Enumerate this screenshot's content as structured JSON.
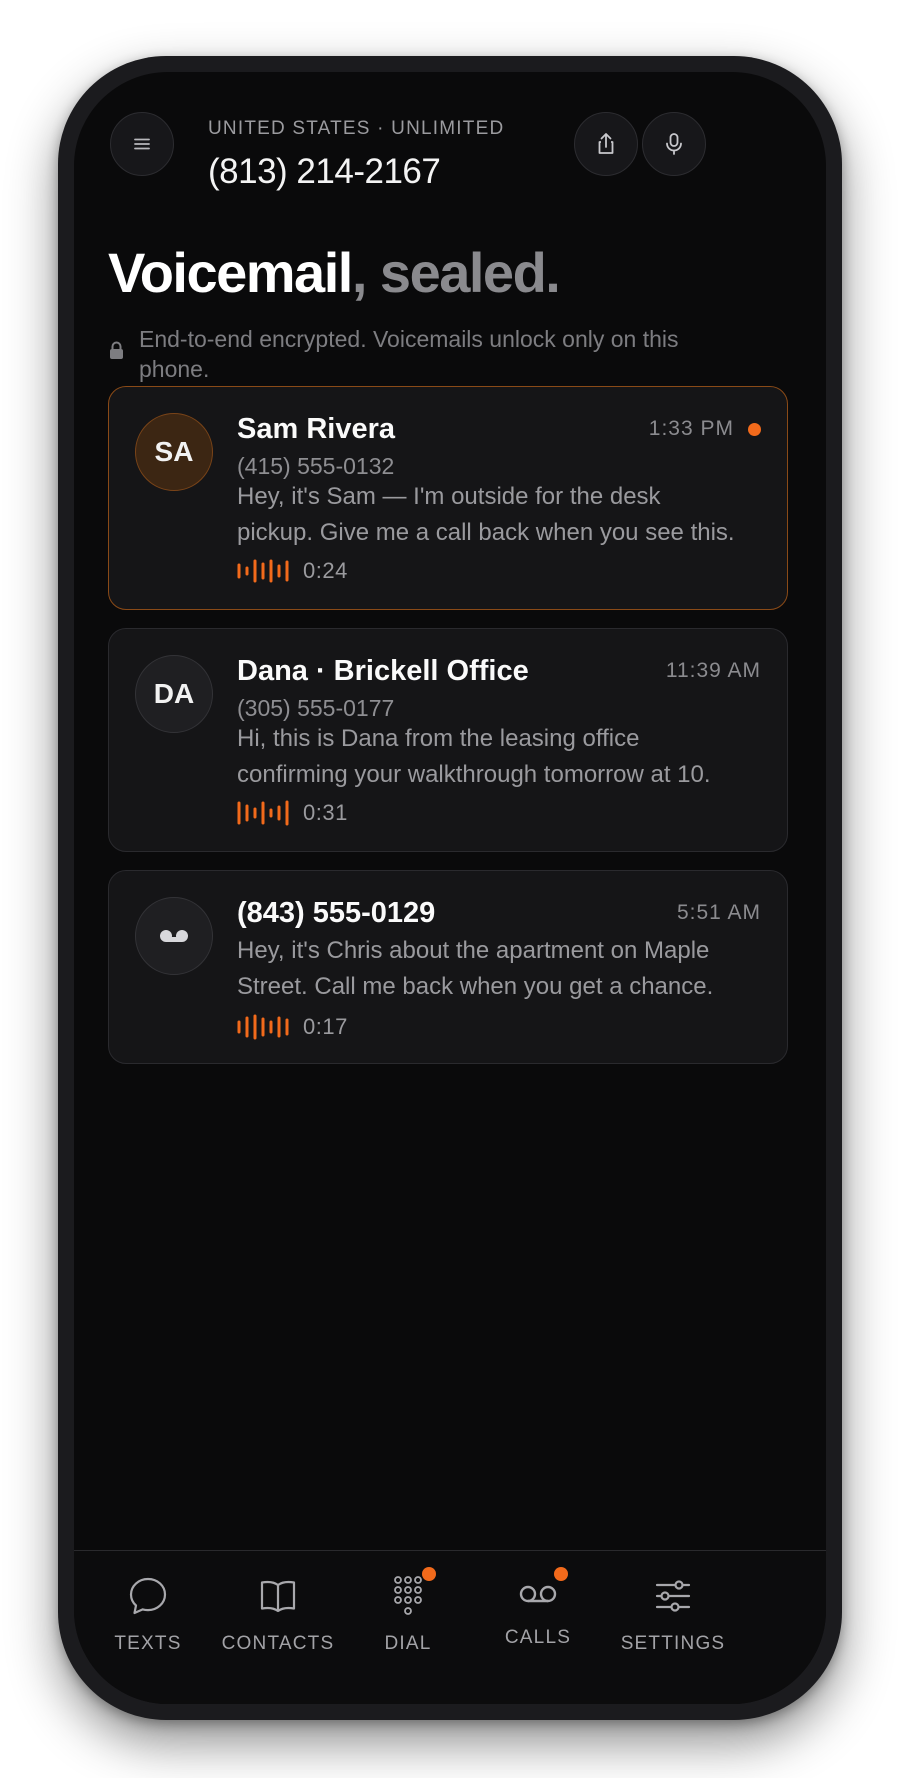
{
  "header": {
    "country": "UNITED STATES · UNLIMITED",
    "number": "(813) 214-2167"
  },
  "title": {
    "main": "Voicemail",
    "accent": ", sealed."
  },
  "encryption_note": "End-to-end encrypted. Voicemails unlock only on this phone.",
  "voicemails": [
    {
      "initials": "SA",
      "name": "Sam Rivera",
      "number": "(415) 555-0132",
      "time": "1:33 PM",
      "unread": true,
      "message": "Hey, it's Sam — I'm outside for the desk pickup. Give me a call back when you see this.",
      "message_line1": "Hey, it's Sam — I'm outside for the desk",
      "message_line2": "pickup. Give me a call back when you see this.",
      "duration": "0:24"
    },
    {
      "initials": "DA",
      "name": "Dana · Brickell Office",
      "number": "(305) 555-0177",
      "time": "11:39 AM",
      "unread": false,
      "message_line1": "Hi, this is Dana from the leasing office",
      "message_line2": "confirming your walkthrough tomorrow at 10.",
      "duration": "0:31"
    },
    {
      "initials": "",
      "name": "(843) 555-0129",
      "time": "5:51 AM",
      "unread": false,
      "message_line1": "Hey, it's Chris about the apartment on Maple",
      "message_line2": "Street. Call me back when you get a chance.",
      "duration": "0:17"
    }
  ],
  "tabs": [
    {
      "label": "TEXTS",
      "icon": "chat-bubble-icon",
      "badge": false
    },
    {
      "label": "CONTACTS",
      "icon": "book-icon",
      "badge": false
    },
    {
      "label": "DIAL",
      "icon": "keypad-icon",
      "badge": true
    },
    {
      "label": "CALLS",
      "icon": "voicemail-icon",
      "badge": true
    },
    {
      "label": "SETTINGS",
      "icon": "sliders-icon",
      "badge": false
    }
  ],
  "colors": {
    "accent": "#f26a1b",
    "background": "#0a0a0b",
    "card": "#151517",
    "active_border": "#8a4a17"
  }
}
